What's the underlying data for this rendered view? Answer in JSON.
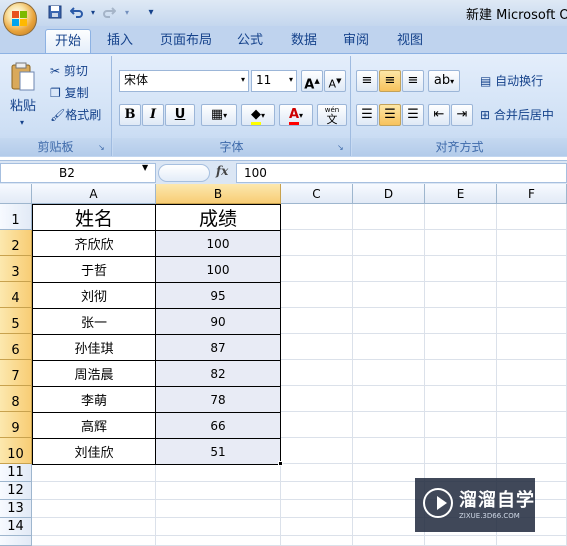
{
  "window": {
    "title": "新建 Microsoft Ot"
  },
  "quick_access": {
    "save": "save-icon",
    "undo": "undo-icon",
    "redo": "redo-icon",
    "customize": "▾"
  },
  "tabs": [
    "开始",
    "插入",
    "页面布局",
    "公式",
    "数据",
    "审阅",
    "视图"
  ],
  "ribbon": {
    "clipboard": {
      "paste": "粘贴",
      "cut": "剪切",
      "copy": "复制",
      "format_painter": "格式刷",
      "label": "剪贴板"
    },
    "font": {
      "name": "宋体",
      "size": "11",
      "bold": "B",
      "italic": "I",
      "underline": "U",
      "grow": "A",
      "shrink": "A",
      "label": "字体",
      "wen": "wén",
      "wen_char": "文"
    },
    "alignment": {
      "wrap_text": "自动换行",
      "merge_center": "合并后居中",
      "label": "对齐方式"
    }
  },
  "formula_bar": {
    "cell_ref": "B2",
    "fx": "fx",
    "value": "100"
  },
  "grid": {
    "columns": [
      "A",
      "B",
      "C",
      "D",
      "E",
      "F"
    ],
    "rows": [
      "1",
      "2",
      "3",
      "4",
      "5",
      "6",
      "7",
      "8",
      "9",
      "10",
      "11",
      "12",
      "13",
      "14"
    ],
    "header": [
      "姓名",
      "成绩"
    ],
    "records": [
      [
        "齐欣欣",
        "100"
      ],
      [
        "于哲",
        "100"
      ],
      [
        "刘彻",
        "95"
      ],
      [
        "张一",
        "90"
      ],
      [
        "孙佳琪",
        "87"
      ],
      [
        "周浩晨",
        "82"
      ],
      [
        "李萌",
        "78"
      ],
      [
        "高辉",
        "66"
      ],
      [
        "刘佳欣",
        "51"
      ]
    ]
  },
  "watermark": {
    "title": "溜溜自学",
    "url": "ZIXUE.3D66.COM"
  },
  "colors": {
    "selection_header": "#f8cd75",
    "ribbon_bg": "#cfe0f5",
    "tab_row": "#bfd3ee"
  }
}
